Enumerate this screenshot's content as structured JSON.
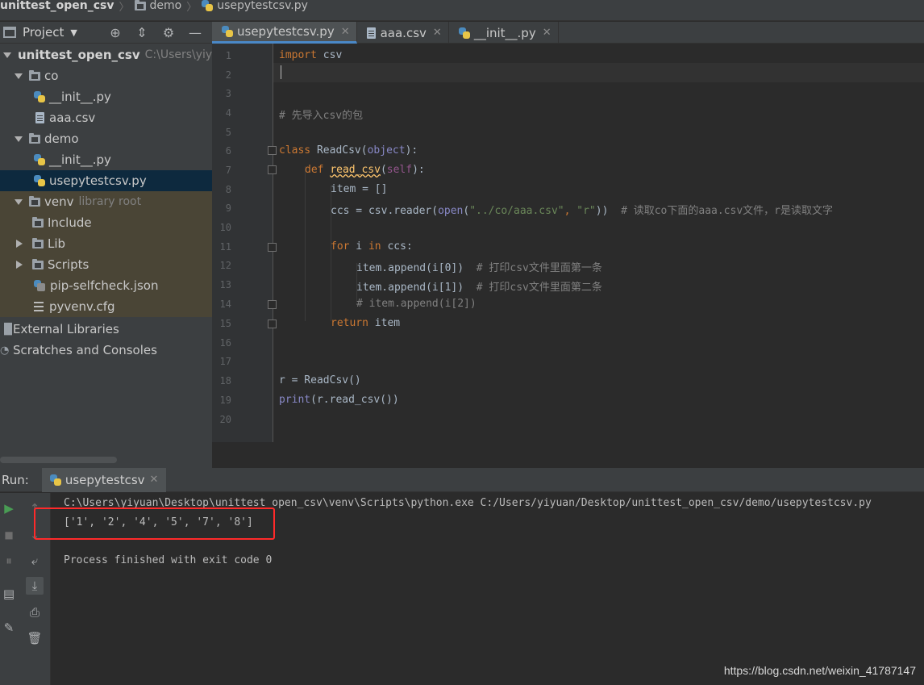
{
  "breadcrumb": {
    "project": "unittest_open_csv",
    "folder": "demo",
    "file": "usepytestcsv.py"
  },
  "project_panel": {
    "title": "Project",
    "tree": [
      {
        "label": "unittest_open_csv",
        "hint": "C:\\Users\\yiyua"
      },
      {
        "label": "co"
      },
      {
        "label": "__init__.py"
      },
      {
        "label": "aaa.csv"
      },
      {
        "label": "demo"
      },
      {
        "label": "__init__.py"
      },
      {
        "label": "usepytestcsv.py"
      },
      {
        "label": "venv",
        "hint": "library root"
      },
      {
        "label": "Include"
      },
      {
        "label": "Lib"
      },
      {
        "label": "Scripts"
      },
      {
        "label": "pip-selfcheck.json"
      },
      {
        "label": "pyvenv.cfg"
      },
      {
        "label": "External Libraries"
      },
      {
        "label": "Scratches and Consoles"
      }
    ]
  },
  "editor_tabs": [
    {
      "label": "usepytestcsv.py"
    },
    {
      "label": "aaa.csv"
    },
    {
      "label": "__init__.py"
    }
  ],
  "line_numbers": [
    "1",
    "2",
    "3",
    "4",
    "5",
    "6",
    "7",
    "8",
    "9",
    "10",
    "11",
    "12",
    "13",
    "14",
    "15",
    "16",
    "17",
    "18",
    "19",
    "20"
  ],
  "code": {
    "l1_kw": "import",
    "l1_rest": " csv",
    "l4": "# 先导入csv的包",
    "l6_kw": "class",
    "l6_name": " ReadCsv(",
    "l6_base": "object",
    "l6_end": "):",
    "l7_kw": "def ",
    "l7_fn": "read_csv",
    "l7_open": "(",
    "l7_self": "self",
    "l7_end": "):",
    "l8": "item = []",
    "l9_a": "ccs = csv.reader(",
    "l9_open": "open",
    "l9_b": "(",
    "l9_s1": "\"../co/aaa.csv\"",
    "l9_c": ", ",
    "l9_s2": "\"r\"",
    "l9_d": "))  ",
    "l9_cm": "# 读取co下面的aaa.csv文件，r是读取文字",
    "l11_for": "for",
    "l11_i": " i ",
    "l11_in": "in",
    "l11_rest": " ccs:",
    "l12_code": "item.append(i[0])  ",
    "l12_cm": "# 打印csv文件里面第一条",
    "l13_code": "item.append(i[1])  ",
    "l13_cm": "# 打印csv文件里面第二条",
    "l14": "# item.append(i[2])",
    "l15_kw": "return",
    "l15_rest": " item",
    "l18": "r = ReadCsv()",
    "l19_print": "print",
    "l19_rest": "(r.read_csv())"
  },
  "run_panel": {
    "label": "Run:",
    "tab": "usepytestcsv"
  },
  "console": {
    "command": "C:\\Users\\yiyuan\\Desktop\\unittest_open_csv\\venv\\Scripts\\python.exe C:/Users/yiyuan/Desktop/unittest_open_csv/demo/usepytestcsv.py",
    "output": "['1', '2', '4', '5', '7', '8']",
    "exit": "Process finished with exit code 0"
  },
  "watermark": "https://blog.csdn.net/weixin_41787147",
  "colors": {
    "accent": "#4a88c7",
    "highlight_box": "#ff2a2a",
    "keyword": "#cc7832"
  }
}
